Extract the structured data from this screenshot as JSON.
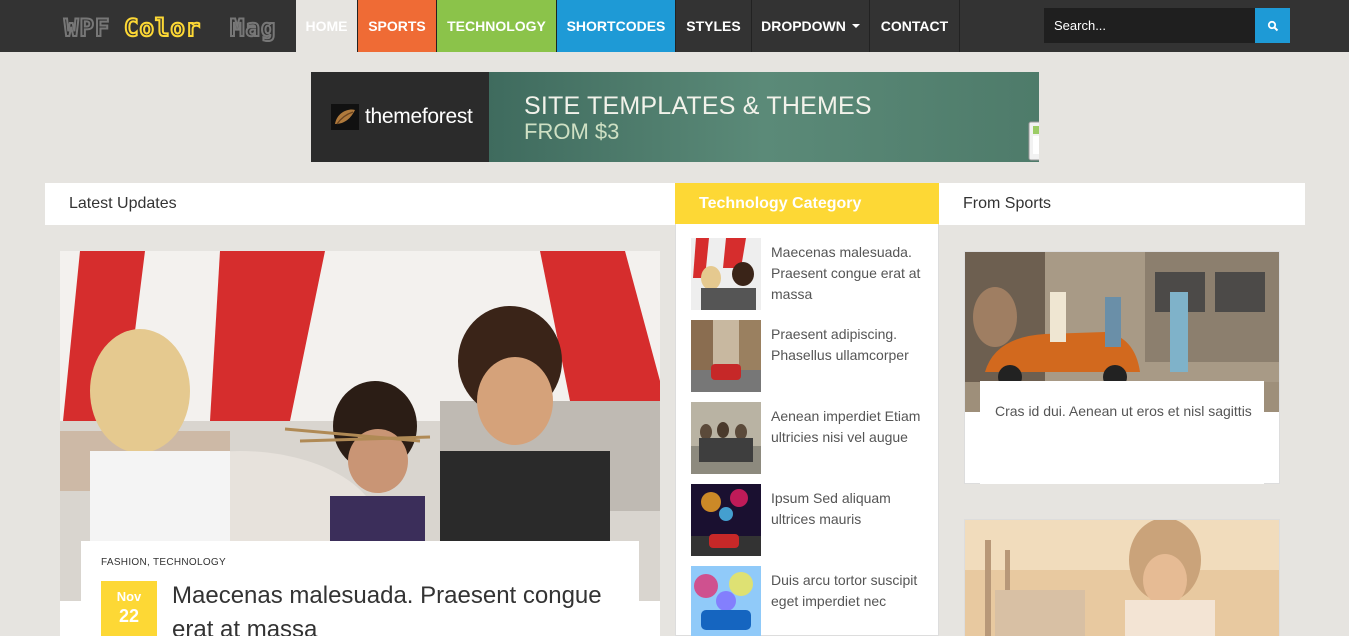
{
  "site": {
    "logo_text": "WPF Color Mag"
  },
  "nav": {
    "items": [
      {
        "label": "HOME",
        "color": "#e6e4e0",
        "text_color": "#ffffff",
        "name": "nav-home"
      },
      {
        "label": "SPORTS",
        "color": "#ef6b35",
        "text_color": "#ffffff",
        "name": "nav-sports"
      },
      {
        "label": "TECHNOLOGY",
        "color": "#8bc34a",
        "text_color": "#ffffff",
        "name": "nav-technology"
      },
      {
        "label": "SHORTCODES",
        "color": "#1e9ad6",
        "text_color": "#ffffff",
        "name": "nav-shortcodes"
      },
      {
        "label": "STYLES",
        "color": "#333333",
        "text_color": "#ffffff",
        "name": "nav-styles"
      },
      {
        "label": "DROPDOWN",
        "color": "#333333",
        "text_color": "#ffffff",
        "name": "nav-dropdown"
      },
      {
        "label": "CONTACT",
        "color": "#333333",
        "text_color": "#ffffff",
        "name": "nav-contact"
      }
    ],
    "search_placeholder": "Search..."
  },
  "banner": {
    "brand": "themeforest",
    "line1": "SITE TEMPLATES & THEMES",
    "line2": "FROM $3"
  },
  "sections": {
    "latest": "Latest Updates",
    "tech": "Technology Category",
    "sports": "From Sports"
  },
  "feature": {
    "categories": "FASHION, TECHNOLOGY",
    "month": "Nov",
    "day": "22",
    "title": "Maecenas malesuada. Praesent congue erat at massa"
  },
  "tech_items": [
    {
      "title": "Maecenas malesuada. Praesent congue erat at massa"
    },
    {
      "title": "Praesent adipiscing. Phasellus ullamcorper"
    },
    {
      "title": "Aenean imperdiet Etiam ultricies nisi vel augue"
    },
    {
      "title": "Ipsum Sed aliquam ultrices mauris"
    },
    {
      "title": "Duis arcu tortor suscipit eget imperdiet nec"
    }
  ],
  "sports_items": [
    {
      "title": "Cras id dui. Aenean ut eros et nisl sagittis"
    }
  ],
  "colors": {
    "accent_yellow": "#fdd835",
    "accent_blue": "#1e9ad6",
    "topbar": "#333333"
  }
}
